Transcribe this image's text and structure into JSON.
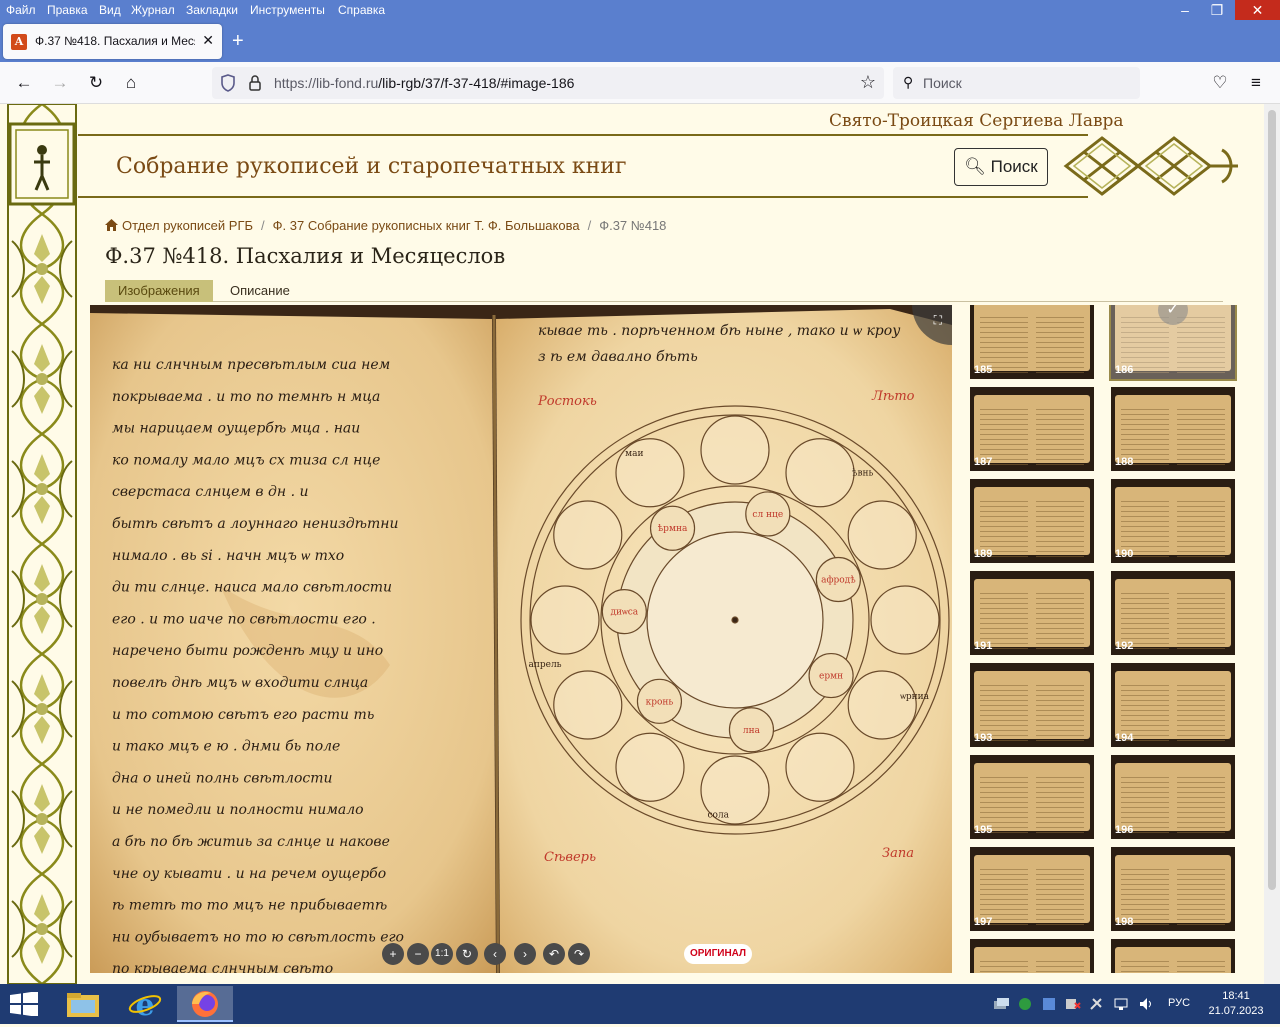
{
  "menubar": {
    "items": [
      "Файл",
      "Правка",
      "Вид",
      "Журнал",
      "Закладки",
      "Инструменты",
      "Справка"
    ],
    "minimize": "–",
    "maximize": "❐",
    "close": "✕"
  },
  "tab": {
    "title": "Ф.37 №418. Пасхалия и Месяцеслов",
    "close": "✕",
    "new": "+"
  },
  "navbar": {
    "url_host": "https://lib-fond.ru",
    "url_path": "/lib-rgb/37/f-37-418/#image-186",
    "search_placeholder": "Поиск"
  },
  "site": {
    "lavra": "Свято-Троицкая Сергиева Лавра",
    "title": "Собрание рукописей и старопечатных книг",
    "search_button": "Поиск"
  },
  "breadcrumb": {
    "home": "Отдел рукописей РГБ",
    "fond": "Ф. 37 Собрание рукописных книг Т. Ф. Большакова",
    "current": "Ф.37 №418"
  },
  "page_title": "Ф.37 №418. Пасхалия и Месяцеслов",
  "page_tabs": {
    "images": "Изображения",
    "description": "Описание"
  },
  "viewer": {
    "original_button": "ОРИГИНАЛ",
    "controls": [
      "+",
      "−",
      "1:1",
      "↻",
      "‹",
      "›",
      "↶",
      "↷"
    ],
    "fullscreen_icon": "⛶",
    "manuscript_left_lines": [
      "ка ни слнчным пресвѣтлым сиа нем",
      "покрываема . и то по темнѣ н мца",
      "мы нарицаем оущербѣ мца . наи",
      "ко помалу мало мцъ сх тиза сл нце",
      "сверстаса слнцем в дн . и",
      "бытѣ свѣтъ а лоуннаго нениздѣтни",
      "нимало . вь si . начн мцъ ѡ тхо",
      "ди ти слнце. наиса мало свѣтлости",
      "его . и то иаче по свѣтлости его .",
      "наречено быти рожденѣ мцу и ино",
      "повелѣ днѣ мцъ ѡ входити слнца",
      "и то сотмою свѣтъ его расти ть",
      "и тако мцъ е ю . днми бь поле",
      "дна о иней полнь свѣтлости",
      "и не помедли и полности нимало",
      "а бѣ по бѣ житиь за слнце и накове",
      "чне оу кывати . и на речем оущербо",
      "ѣ тетѣ то то мцъ не прибываетѣ",
      "ни оубываетъ но то ю свѣтлость его",
      "по крываема слнчным свѣто"
    ],
    "manuscript_right_lines": [
      "кывае ть . порѣченном бѣ ныне , тако и ѡ кроу",
      "з ѣ ем давално бѣть"
    ],
    "directions": {
      "east": "Ростокь",
      "north": "Лѣто",
      "south": "Сѣверь",
      "west": "Запа"
    },
    "wheel_labels": [
      "сл нце",
      "афродѣ",
      "ермн",
      "лна",
      "кронь",
      "диѡса",
      "ѣрмна",
      "ѡрниа",
      "сола",
      "апрель",
      "маи",
      "ѣвнь"
    ]
  },
  "thumbnails": [
    {
      "num": "185",
      "active": false
    },
    {
      "num": "186",
      "active": true
    },
    {
      "num": "187",
      "active": false
    },
    {
      "num": "188",
      "active": false
    },
    {
      "num": "189",
      "active": false
    },
    {
      "num": "190",
      "active": false
    },
    {
      "num": "191",
      "active": false
    },
    {
      "num": "192",
      "active": false
    },
    {
      "num": "193",
      "active": false
    },
    {
      "num": "194",
      "active": false
    },
    {
      "num": "195",
      "active": false
    },
    {
      "num": "196",
      "active": false
    },
    {
      "num": "197",
      "active": false
    },
    {
      "num": "198",
      "active": false
    },
    {
      "num": "",
      "active": false
    },
    {
      "num": "",
      "active": false
    }
  ],
  "taskbar": {
    "apps": [
      "file-explorer",
      "internet-explorer",
      "firefox"
    ],
    "tray_lang": "РУС",
    "time": "18:41",
    "date": "21.07.2023"
  },
  "colors": {
    "accent_brown": "#7a4a14",
    "active_tab": "#c8c07a",
    "firefox_blue": "#5a7fce",
    "taskbar": "#1f3b72"
  }
}
